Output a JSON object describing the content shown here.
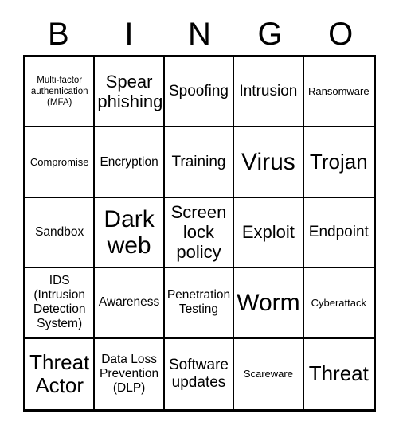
{
  "card": {
    "header_letters": [
      "B",
      "I",
      "N",
      "G",
      "O"
    ],
    "border_color": "#000000",
    "cell_background": "#ffffff",
    "text_color": "#000000",
    "columns": 5,
    "rows": 5,
    "cells": [
      {
        "text": "Multi-factor\nauthentication\n(MFA)",
        "size": "fs-xs",
        "column": "B",
        "row": 1
      },
      {
        "text": "Spear\nphishing",
        "size": "fs-xl",
        "column": "I",
        "row": 1
      },
      {
        "text": "Spoofing",
        "size": "fs-lg",
        "column": "N",
        "row": 1
      },
      {
        "text": "Intrusion",
        "size": "fs-lg",
        "column": "G",
        "row": 1
      },
      {
        "text": "Ransomware",
        "size": "fs-sm",
        "column": "O",
        "row": 1
      },
      {
        "text": "Compromise",
        "size": "fs-sm",
        "column": "B",
        "row": 2
      },
      {
        "text": "Encryption",
        "size": "fs-md",
        "column": "I",
        "row": 2
      },
      {
        "text": "Training",
        "size": "fs-lg",
        "column": "N",
        "row": 2
      },
      {
        "text": "Virus",
        "size": "fs-3xl",
        "column": "G",
        "row": 2
      },
      {
        "text": "Trojan",
        "size": "fs-2xl",
        "column": "O",
        "row": 2
      },
      {
        "text": "Sandbox",
        "size": "fs-md",
        "column": "B",
        "row": 3
      },
      {
        "text": "Dark\nweb",
        "size": "fs-3xl",
        "column": "I",
        "row": 3
      },
      {
        "text": "Screen\nlock\npolicy",
        "size": "fs-xl",
        "column": "N",
        "row": 3
      },
      {
        "text": "Exploit",
        "size": "fs-xl",
        "column": "G",
        "row": 3
      },
      {
        "text": "Endpoint",
        "size": "fs-lg",
        "column": "O",
        "row": 3
      },
      {
        "text": "IDS\n(Intrusion\nDetection\nSystem)",
        "size": "fs-md",
        "column": "B",
        "row": 4
      },
      {
        "text": "Awareness",
        "size": "fs-md",
        "column": "I",
        "row": 4
      },
      {
        "text": "Penetration\nTesting",
        "size": "fs-md",
        "column": "N",
        "row": 4
      },
      {
        "text": "Worm",
        "size": "fs-3xl",
        "column": "G",
        "row": 4
      },
      {
        "text": "Cyberattack",
        "size": "fs-sm",
        "column": "O",
        "row": 4
      },
      {
        "text": "Threat\nActor",
        "size": "fs-2xl",
        "column": "B",
        "row": 5
      },
      {
        "text": "Data Loss\nPrevention\n(DLP)",
        "size": "fs-md",
        "column": "I",
        "row": 5
      },
      {
        "text": "Software\nupdates",
        "size": "fs-lg",
        "column": "N",
        "row": 5
      },
      {
        "text": "Scareware",
        "size": "fs-sm",
        "column": "G",
        "row": 5
      },
      {
        "text": "Threat",
        "size": "fs-2xl",
        "column": "O",
        "row": 5
      }
    ]
  }
}
